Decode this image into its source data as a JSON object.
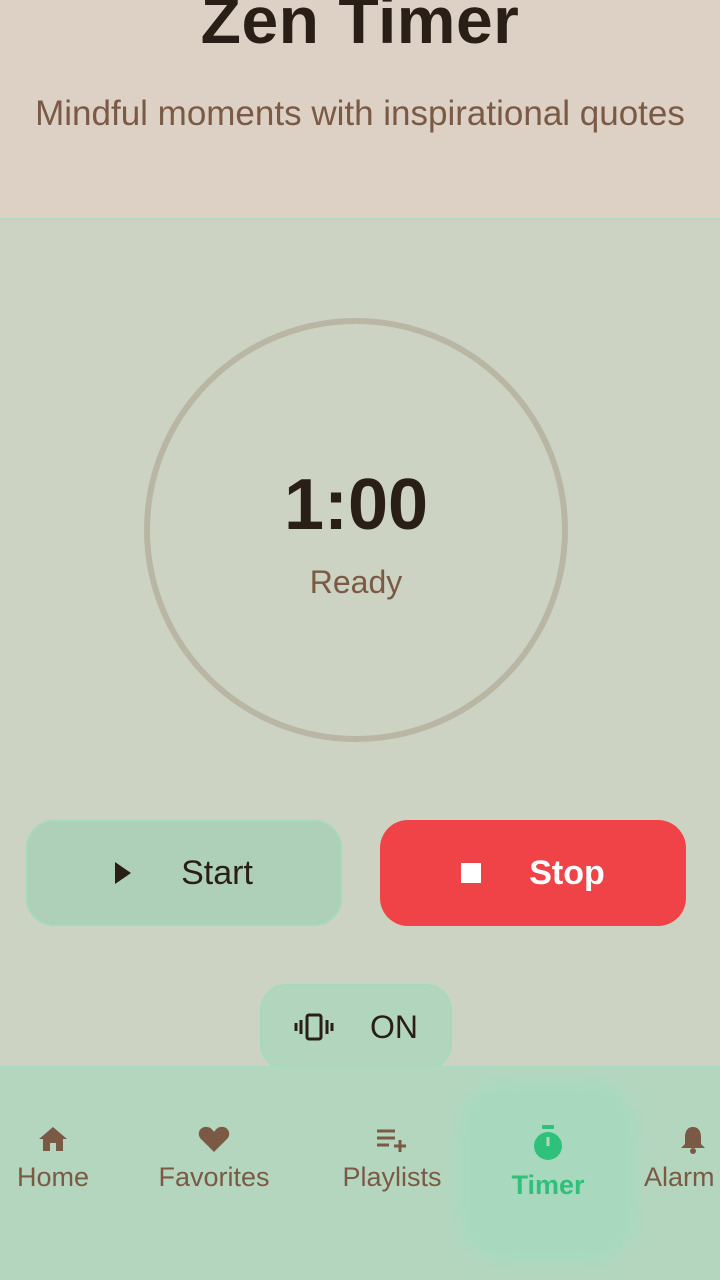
{
  "header": {
    "title": "Zen Timer",
    "subtitle": "Mindful moments with inspirational quotes"
  },
  "timer": {
    "time": "1:00",
    "status": "Ready"
  },
  "controls": {
    "start_label": "Start",
    "stop_label": "Stop",
    "vibrate_label": "ON"
  },
  "nav": {
    "items": [
      {
        "label": "Home",
        "icon": "home-icon"
      },
      {
        "label": "Favorites",
        "icon": "heart-icon"
      },
      {
        "label": "Playlists",
        "icon": "playlist-add-icon"
      },
      {
        "label": "Timer",
        "icon": "stopwatch-icon",
        "active": true
      },
      {
        "label": "Alarm",
        "icon": "bell-icon"
      }
    ]
  },
  "colors": {
    "accent": "#2fc17a",
    "stop": "#ef4347",
    "header_bg": "#ddd1c5",
    "main_bg": "#ccd3c3"
  }
}
